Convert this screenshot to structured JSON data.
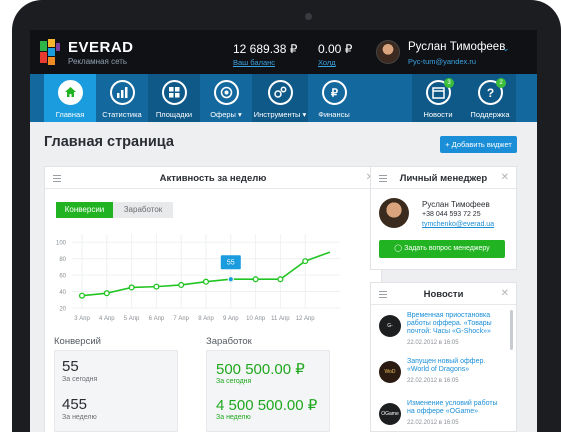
{
  "brand": {
    "name": "EVERAD",
    "subtitle": "Рекламная сеть"
  },
  "header": {
    "balance_value": "12 689.38 ₽",
    "balance_label": "Ваш баланс",
    "hold_value": "0.00 ₽",
    "hold_label": "Холд",
    "user_name": "Руслан Тимофеев",
    "user_email": "Pyc-tum@yandex.ru"
  },
  "nav": {
    "items": [
      {
        "label": "Главная",
        "icon": "home-icon"
      },
      {
        "label": "Статистика",
        "icon": "bar-chart-icon"
      },
      {
        "label": "Площадки",
        "icon": "grid-icon"
      },
      {
        "label": "Оферы ▾",
        "icon": "target-icon"
      },
      {
        "label": "Инструменты ▾",
        "icon": "gears-icon"
      },
      {
        "label": "Финансы",
        "icon": "ruble-icon"
      },
      {
        "label": "Новости",
        "icon": "calendar-icon",
        "badge": "3"
      },
      {
        "label": "Поддержка",
        "icon": "question-icon",
        "badge": "2"
      }
    ]
  },
  "page": {
    "title": "Главная страница",
    "add_widget": "+ Добавить виджет"
  },
  "activity": {
    "title": "Активность за неделю",
    "tab_conversions": "Конверсии",
    "tab_earnings": "Заработок"
  },
  "chart_data": {
    "type": "line",
    "categories": [
      "3 Апр",
      "4 Апр",
      "5 Апр",
      "6 Апр",
      "7 Апр",
      "8 Апр",
      "9 Апр",
      "10 Апр",
      "11 Апр",
      "12 Апр"
    ],
    "values": [
      35,
      38,
      45,
      46,
      48,
      52,
      55,
      55,
      55,
      77
    ],
    "extra_point": {
      "x_after": "12 Апр",
      "value": 88
    },
    "highlight": {
      "category": "9 Апр",
      "label": "55"
    },
    "ylim": [
      20,
      110
    ],
    "yticks": [
      20,
      40,
      60,
      80,
      100
    ],
    "color": "#21c521",
    "grid": true
  },
  "stats": {
    "conversions_title": "Конверсий",
    "conv_today_value": "55",
    "conv_today_label": "За сегодня",
    "conv_week_value": "455",
    "conv_week_label": "За неделю",
    "earnings_title": "Заработок",
    "earn_today_value": "500 500.00 ₽",
    "earn_today_label": "За сегодня",
    "earn_week_value": "4 500 500.00 ₽",
    "earn_week_label": "За неделю"
  },
  "manager": {
    "title": "Личный менеджер",
    "name": "Руслан Тимофеев",
    "phone": "+38 044 593 72 25",
    "email": "tymchenko@everad.ua",
    "ask_button": "Задать вопрос менеджеру"
  },
  "news": {
    "title": "Новости",
    "items": [
      {
        "logo": "G-SHOCK",
        "text": "Временная приостановка работы оффера. «Товары почтой: Часы «G-Shock»»",
        "date": "22.02.2012 в 16:05"
      },
      {
        "logo": "WoD",
        "text": "Запущен новый оффер. «World of Dragons»",
        "date": "22.02.2012 в 16:05"
      },
      {
        "logo": "OGame",
        "text": "Изменение условий работы на оффере «OGame»",
        "date": "22.02.2012 в 16:05"
      }
    ]
  },
  "colors": {
    "nav": "#13689e",
    "nav_active": "#1a9cde",
    "green": "#21b321",
    "blue": "#1a8fd8"
  }
}
